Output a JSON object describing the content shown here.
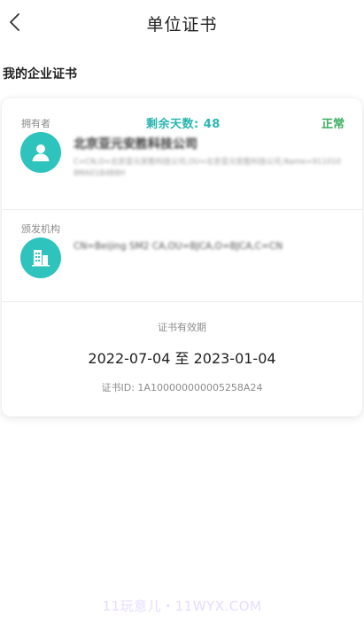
{
  "nav": {
    "title": "单位证书",
    "back_icon": "chevron-left-icon"
  },
  "section": {
    "title": "我的企业证书"
  },
  "card": {
    "owner_label": "拥有者",
    "days_left": "剩余天数: 48",
    "status": "正常",
    "status_color": "#3aaf5e",
    "accent_color": "#2ec3bd",
    "owner_icon": "person-icon",
    "company_name": "北京亚元安胜科技公司",
    "subject_dn": "C=CN,O=北京亚元安胜科技公司,OU=北京亚元安胜科技公司,Name=9110108MA01B4B8H",
    "issuer_label": "颁发机构",
    "issuer_icon": "building-icon",
    "issuer_dn": "CN=Beijing SM2 CA,OU=BJCA,O=BJCA,C=CN",
    "validity_label": "证书有效期",
    "validity_range": "2022-07-04 至 2023-01-04",
    "cert_id": "证书ID: 1A100000000005258A24"
  },
  "watermark": "11玩意儿・11WYX.COM"
}
